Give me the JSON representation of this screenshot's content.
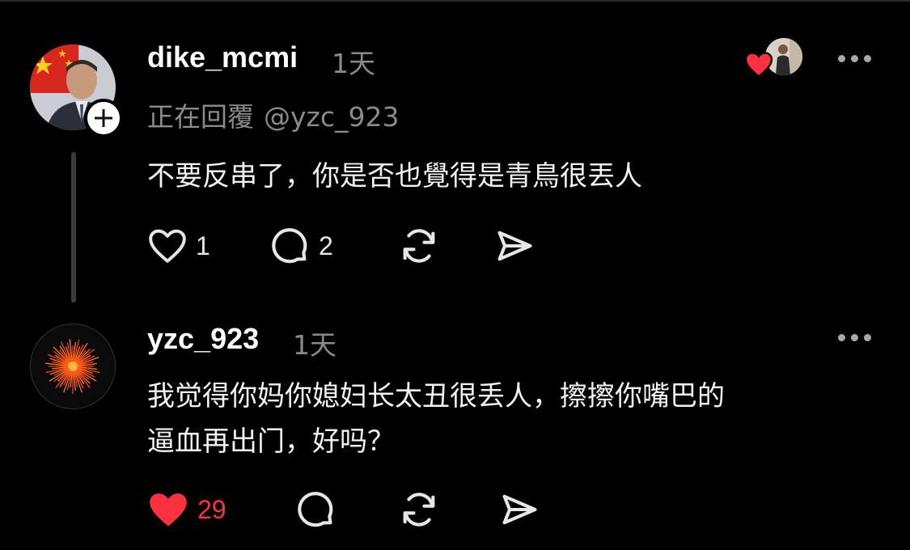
{
  "comments": [
    {
      "username": "dike_mcmi",
      "time": "1天",
      "replying_prefix": "正在回覆",
      "replying_handle": "@yzc_923",
      "text": "不要反串了，你是否也覺得是青鳥很丟人",
      "likes": "1",
      "replies": "2",
      "liked": false,
      "author_liked": true
    },
    {
      "username": "yzc_923",
      "time": "1天",
      "text_line1": "我觉得你妈你媳妇长太丑很丢人，擦擦你嘴巴的",
      "text_line2": "逼血再出门，好吗？",
      "likes": "29",
      "liked": true
    }
  ],
  "colors": {
    "background": "#000000",
    "like_red": "#ff3040",
    "muted": "#8a8a8a"
  },
  "icons": [
    "heart-icon",
    "comment-icon",
    "repost-icon",
    "share-icon",
    "more-icon",
    "plus-icon"
  ]
}
